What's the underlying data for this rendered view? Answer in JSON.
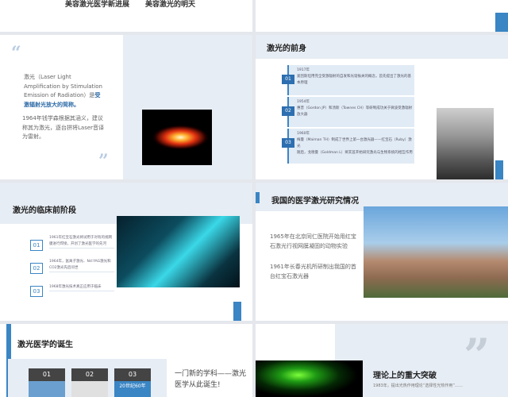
{
  "slide1": {
    "label_a": "美容激光医学新进展",
    "label_b": "美容激光的明天"
  },
  "slide3": {
    "quote_open": "“",
    "quote_close": "”",
    "para1_normal": "激光（Laser Light Amplification by Stimulation Emission of Radiation）是",
    "para1_bold": "受激辐射光放大的简称。",
    "para2": "1964年钱学森根据其涵义，建议称其为激光，逐台拼将Laser音译为雷射。"
  },
  "slide4": {
    "title": "激光的前身",
    "timeline": [
      {
        "num": "01",
        "text": "1917年\n爱因斯坦用完全受激辐射的自发和光谐振关的概念，首先提出了激光的基本原理"
      },
      {
        "num": "02",
        "text": "1954年\n惠普（Gordon JP）和汤斯（Townes CH）等研制成功关于微波受激辐射放大器"
      },
      {
        "num": "03",
        "text": "1960年\n梅曼（Maiman TH）制成了世界上第一台激光器——红宝石（Ruby）激光\n随后，戈德曼（Goldman L）将其首开始研究激光与生物系统的相互作用"
      }
    ]
  },
  "slide5": {
    "title": "激光的临床前阶段",
    "items": [
      {
        "num": "01",
        "text": "1961年红宝石激光将试用于对有的视网膜进行焊接，开创了激光医学的先河"
      },
      {
        "num": "02",
        "text": "1964年，氩离子激光、Nd:YAG激光和CO2激光先后问世"
      },
      {
        "num": "03",
        "text": "1968年激光技术真正应用于临床"
      }
    ]
  },
  "slide6": {
    "title": "我国的医学激光研究情况",
    "para1": "1965年在北京同仁医院开始用红宝石激光行视网膜凝固的动物实验",
    "para2": "1961年长春光机所研制出我国的首台红宝石激光器"
  },
  "slide7": {
    "title": "激光医学的诞生",
    "tagline": "一门新的学科——激光医学从此诞生!",
    "columns": [
      {
        "num": "01",
        "text": ""
      },
      {
        "num": "02",
        "text": ""
      },
      {
        "num": "03",
        "text": "20世纪60年"
      }
    ]
  },
  "slide8": {
    "title": "理论上的重大突破",
    "quote_mark": "”",
    "body": "1983年，提出光热作用理论“选择性光热作用”……"
  }
}
